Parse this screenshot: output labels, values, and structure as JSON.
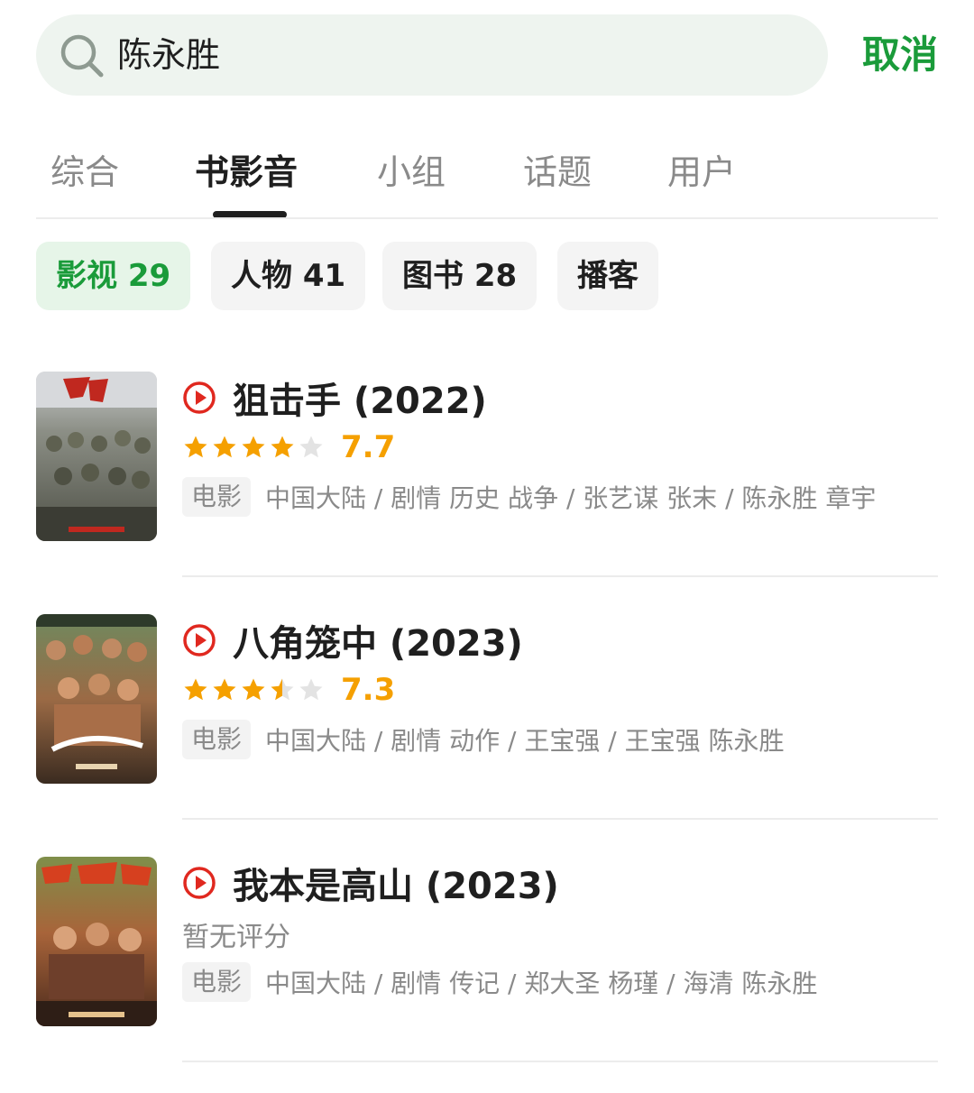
{
  "search": {
    "query": "陈永胜",
    "cancel_label": "取消"
  },
  "tabs": [
    {
      "label": "综合"
    },
    {
      "label": "书影音"
    },
    {
      "label": "小组"
    },
    {
      "label": "话题"
    },
    {
      "label": "用户"
    }
  ],
  "chips": [
    {
      "label": "影视 29"
    },
    {
      "label": "人物 41"
    },
    {
      "label": "图书 28"
    },
    {
      "label": "播客"
    }
  ],
  "results": [
    {
      "title": "狙击手 (2022)",
      "rating": 7.7,
      "rating_text": "7.7",
      "stars": 4,
      "type": "电影",
      "meta": "中国大陆 / 剧情 历史 战争 / 张艺谋 张末 / 陈永胜 章宇"
    },
    {
      "title": "八角笼中 (2023)",
      "rating": 7.3,
      "rating_text": "7.3",
      "stars": 3.5,
      "type": "电影",
      "meta": "中国大陆 / 剧情 动作 / 王宝强 / 王宝强 陈永胜"
    },
    {
      "title": "我本是高山 (2023)",
      "no_rating_text": "暂无评分",
      "type": "电影",
      "meta": "中国大陆 / 剧情 传记 / 郑大圣 杨瑾 / 海清 陈永胜"
    }
  ],
  "colors": {
    "accent": "#1a9b3a",
    "star": "#f5a000",
    "play": "#e0281f"
  }
}
